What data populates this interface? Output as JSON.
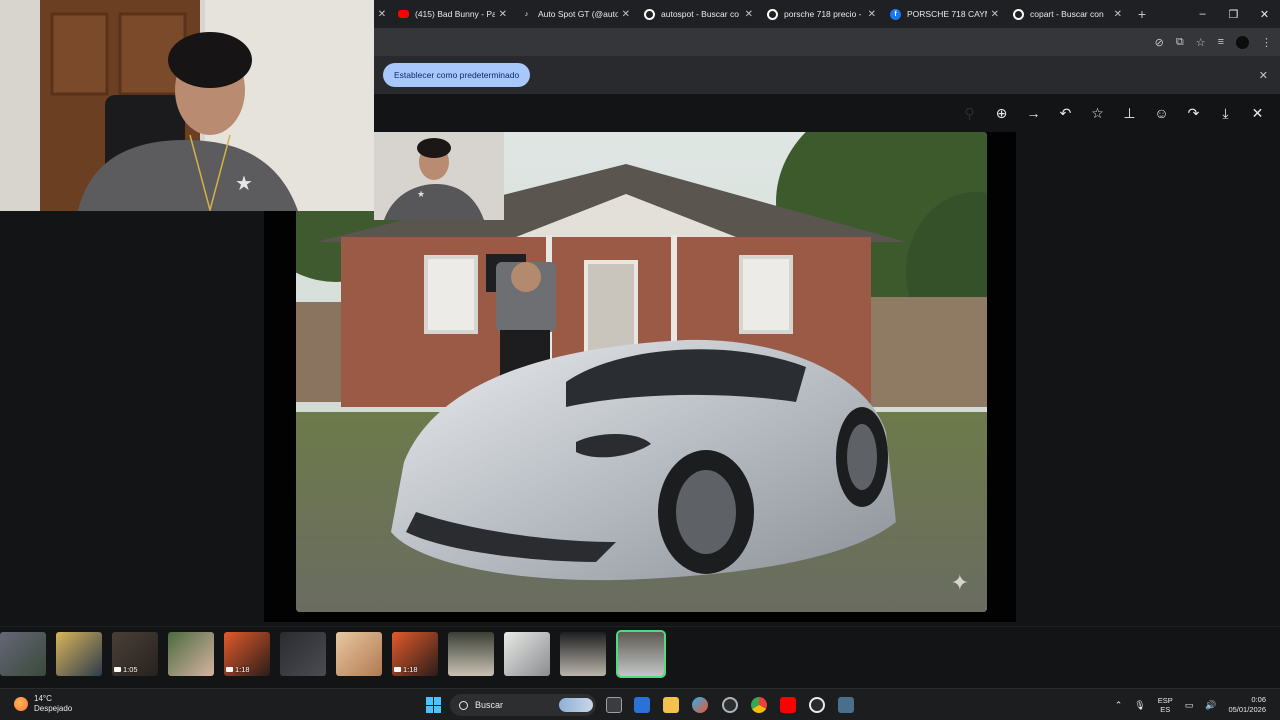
{
  "browser": {
    "tabs": [
      {
        "label": "(415) Bad Bunny - Pa",
        "icon": "youtube-icon",
        "color": "#ff0000"
      },
      {
        "label": "Auto Spot GT (@auto",
        "icon": "tiktok-icon",
        "color": "#ffffff"
      },
      {
        "label": "autospot - Buscar co",
        "icon": "google-icon",
        "color": "#ffffff"
      },
      {
        "label": "porsche 718 precio -",
        "icon": "google-icon",
        "color": "#ffffff"
      },
      {
        "label": "PORSCHE 718 CAYM",
        "icon": "facebook-icon",
        "color": "#1877f2"
      },
      {
        "label": "copart - Buscar con",
        "icon": "google-icon",
        "color": "#ffffff"
      }
    ],
    "new_tab": "+",
    "window_controls": [
      "–",
      "❐",
      "✕"
    ]
  },
  "infobar": {
    "default_button": "Establecer como predeterminado",
    "close": "✕"
  },
  "viewer": {
    "tools": [
      {
        "name": "zoom-out-icon",
        "glyph": "⚲"
      },
      {
        "name": "zoom-in-icon",
        "glyph": "⊕"
      },
      {
        "name": "next-arrow-icon",
        "glyph": "→"
      },
      {
        "name": "reply-icon",
        "glyph": "↶"
      },
      {
        "name": "star-icon",
        "glyph": "☆"
      },
      {
        "name": "pin-icon",
        "glyph": "⊥"
      },
      {
        "name": "emoji-icon",
        "glyph": "☺"
      },
      {
        "name": "forward-icon",
        "glyph": "↷"
      },
      {
        "name": "download-icon",
        "glyph": "⤓"
      },
      {
        "name": "close-icon",
        "glyph": "✕"
      }
    ]
  },
  "filmstrip": {
    "thumbs": [
      {
        "duration": "",
        "video": false
      },
      {
        "duration": "",
        "video": false
      },
      {
        "duration": "1:05",
        "video": true
      },
      {
        "duration": "",
        "video": false
      },
      {
        "duration": "1:18",
        "video": true
      },
      {
        "duration": "",
        "video": false
      },
      {
        "duration": "",
        "video": false
      },
      {
        "duration": "1:18",
        "video": true
      },
      {
        "duration": "",
        "video": false
      },
      {
        "duration": "",
        "video": false
      },
      {
        "duration": "",
        "video": false
      },
      {
        "duration": "",
        "video": false
      }
    ],
    "selected_index": 11
  },
  "taskbar": {
    "temperature": "14°C",
    "weather": "Despejado",
    "search_placeholder": "Buscar",
    "lang_1": "ESP",
    "lang_2": "ES",
    "time": "0:06",
    "date": "05/01/2026"
  },
  "colors": {
    "accent_blue": "#a8c7fa",
    "selected_thumb": "#4ade80"
  }
}
